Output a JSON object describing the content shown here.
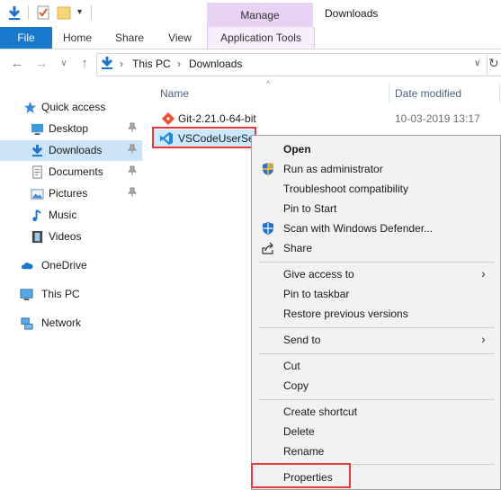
{
  "title_bar": {
    "contextual_tab": "Manage",
    "window_title": "Downloads"
  },
  "ribbon": {
    "tabs": [
      "File",
      "Home",
      "Share",
      "View",
      "Application Tools"
    ]
  },
  "address_bar": {
    "breadcrumbs": [
      "This PC",
      "Downloads"
    ]
  },
  "sidebar": {
    "items": [
      {
        "label": "Quick access",
        "icon": "star-icon"
      },
      {
        "label": "Desktop",
        "icon": "desktop-icon",
        "pinned": true
      },
      {
        "label": "Downloads",
        "icon": "download-arrow-icon",
        "pinned": true,
        "selected": true
      },
      {
        "label": "Documents",
        "icon": "documents-icon",
        "pinned": true
      },
      {
        "label": "Pictures",
        "icon": "pictures-icon",
        "pinned": true
      },
      {
        "label": "Music",
        "icon": "music-note-icon"
      },
      {
        "label": "Videos",
        "icon": "film-icon"
      },
      {
        "label": "OneDrive",
        "icon": "cloud-icon"
      },
      {
        "label": "This PC",
        "icon": "computer-icon"
      },
      {
        "label": "Network",
        "icon": "network-icon"
      }
    ]
  },
  "file_list": {
    "columns": [
      "Name",
      "Date modified"
    ],
    "rows": [
      {
        "name": "Git-2.21.0-64-bit",
        "date": "10-03-2019 13:17",
        "icon": "git-icon"
      },
      {
        "name": "VSCodeUserSet",
        "date": "",
        "icon": "vscode-icon"
      }
    ]
  },
  "context_menu": {
    "groups": [
      [
        {
          "label": "Open",
          "bold": true
        },
        {
          "label": "Run as administrator",
          "icon": "shield-icon"
        },
        {
          "label": "Troubleshoot compatibility"
        },
        {
          "label": "Pin to Start"
        },
        {
          "label": "Scan with Windows Defender...",
          "icon": "defender-icon"
        },
        {
          "label": "Share",
          "icon": "share-icon"
        }
      ],
      [
        {
          "label": "Give access to",
          "submenu": true
        },
        {
          "label": "Pin to taskbar"
        },
        {
          "label": "Restore previous versions"
        }
      ],
      [
        {
          "label": "Send to",
          "submenu": true
        }
      ],
      [
        {
          "label": "Cut"
        },
        {
          "label": "Copy"
        }
      ],
      [
        {
          "label": "Create shortcut"
        },
        {
          "label": "Delete"
        },
        {
          "label": "Rename"
        }
      ],
      [
        {
          "label": "Properties"
        }
      ]
    ]
  },
  "colors": {
    "file_tab": "#1979ca",
    "manage_tab": "#e8d3f5",
    "highlight_box": "#e8393a",
    "selected_nav": "#cce4f7"
  }
}
